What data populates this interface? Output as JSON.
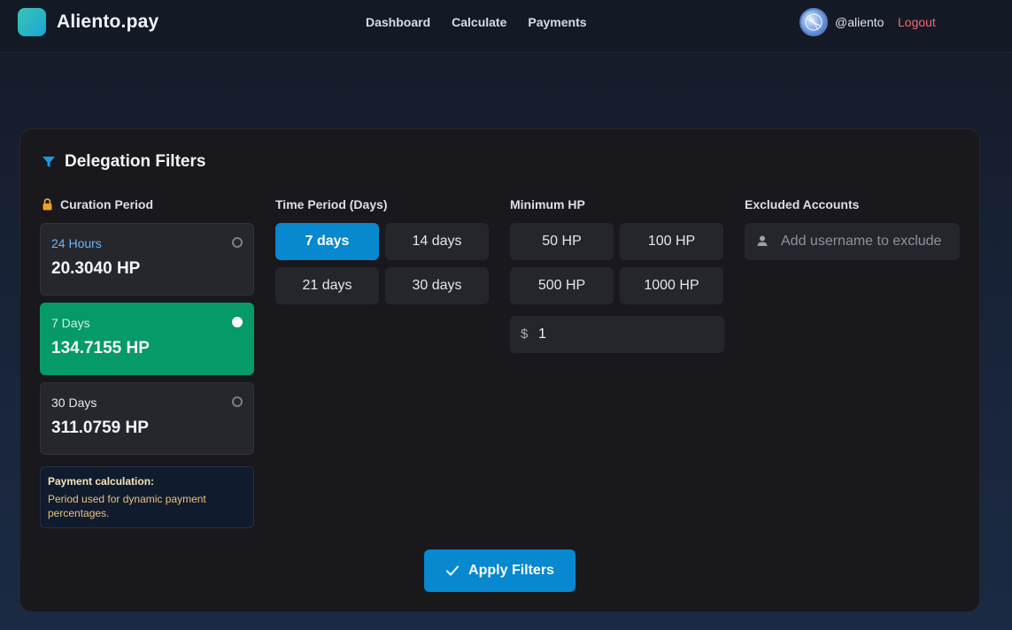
{
  "header": {
    "brand": "Aliento.pay",
    "nav": [
      "Dashboard",
      "Calculate",
      "Payments"
    ],
    "username": "@aliento",
    "logout": "Logout"
  },
  "panel": {
    "title": "Delegation Filters",
    "curation": {
      "label": "Curation Period",
      "options": [
        {
          "label": "24 Hours",
          "value": "20.3040 HP",
          "selected": false
        },
        {
          "label": "7 Days",
          "value": "134.7155 HP",
          "selected": true
        },
        {
          "label": "30 Days",
          "value": "311.0759 HP",
          "selected": false
        }
      ],
      "note_title": "Payment calculation:",
      "note_text": "Period used for dynamic payment percentages."
    },
    "time_period": {
      "label": "Time Period (Days)",
      "options": [
        "7 days",
        "14 days",
        "21 days",
        "30 days"
      ],
      "selected": "7 days"
    },
    "minimum_hp": {
      "label": "Minimum HP",
      "options": [
        "50 HP",
        "100 HP",
        "500 HP",
        "1000 HP"
      ],
      "currency_symbol": "$",
      "amount": "1"
    },
    "excluded": {
      "label": "Excluded Accounts",
      "placeholder": "Add username to exclude"
    },
    "apply_label": "Apply Filters"
  },
  "colors": {
    "accent": "#0788cf",
    "selected_card": "#069a68",
    "logout": "#f06a6a",
    "lock_icon": "#f0a020",
    "note_text": "#e7c27a",
    "card_24h_label": "#6fb4f2"
  }
}
